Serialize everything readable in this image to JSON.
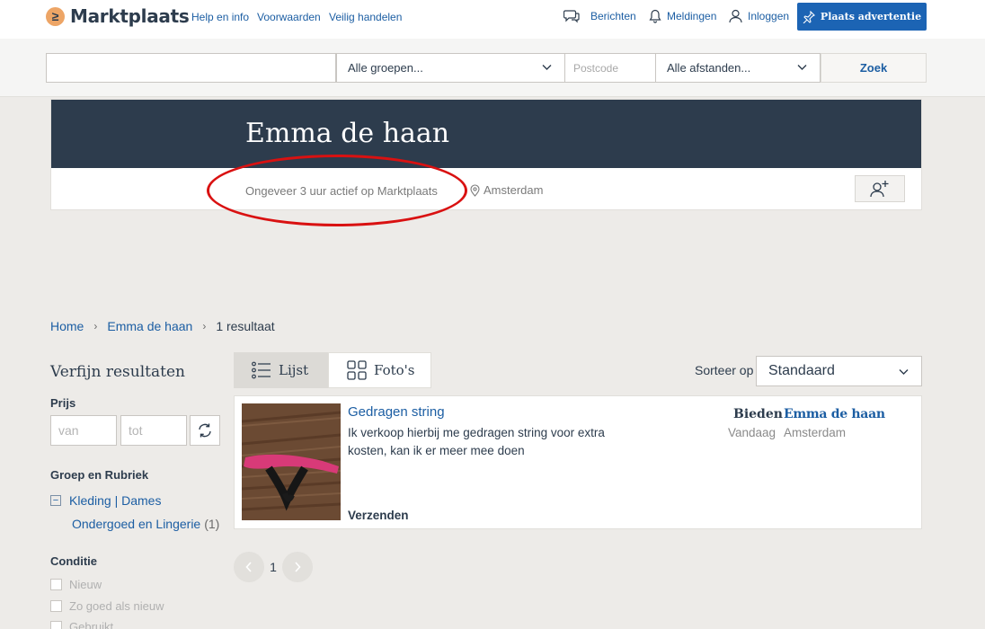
{
  "header": {
    "logo_glyph": "≥",
    "logo_text": "Marktplaats",
    "links": [
      "Help en info",
      "Voorwaarden",
      "Veilig handelen"
    ],
    "nav": {
      "messages": "Berichten",
      "notifications": "Meldingen",
      "login": "Inloggen"
    },
    "place_ad": "Plaats advertentie"
  },
  "search": {
    "query": "",
    "group": "Alle groepen...",
    "postcode_placeholder": "Postcode",
    "distance": "Alle afstanden...",
    "button": "Zoek"
  },
  "profile": {
    "name": "Emma de haan",
    "activity": "Ongeveer 3 uur actief op Marktplaats",
    "location": "Amsterdam"
  },
  "breadcrumb": {
    "home": "Home",
    "seller": "Emma de haan",
    "count": "1 resultaat"
  },
  "filters": {
    "title": "Verfijn resultaten",
    "price_label": "Prijs",
    "price_from_placeholder": "van",
    "price_to_placeholder": "tot",
    "category_label": "Groep en Rubriek",
    "category": "Kleding | Dames",
    "subcategory": "Ondergoed en Lingerie",
    "subcategory_count": "(1)",
    "condition_label": "Conditie",
    "conditions": [
      "Nieuw",
      "Zo goed als nieuw",
      "Gebruikt"
    ]
  },
  "view": {
    "list": "Lijst",
    "photos": "Foto's"
  },
  "sort": {
    "label": "Sorteer op",
    "value": "Standaard"
  },
  "listing": {
    "title": "Gedragen string",
    "description": "Ik verkoop hierbij me gedragen string voor extra kosten, kan ik er meer mee doen",
    "shipping": "Verzenden",
    "price": "Bieden",
    "date": "Vandaag",
    "seller": "Emma de haan",
    "city": "Amsterdam"
  },
  "pagination": {
    "current": "1"
  },
  "colors": {
    "brand_blue": "#1c64b4",
    "link": "#1c5ea3",
    "banner": "#2d3c4d",
    "logo_orange": "#eda566",
    "annotation_red": "#d91111"
  }
}
